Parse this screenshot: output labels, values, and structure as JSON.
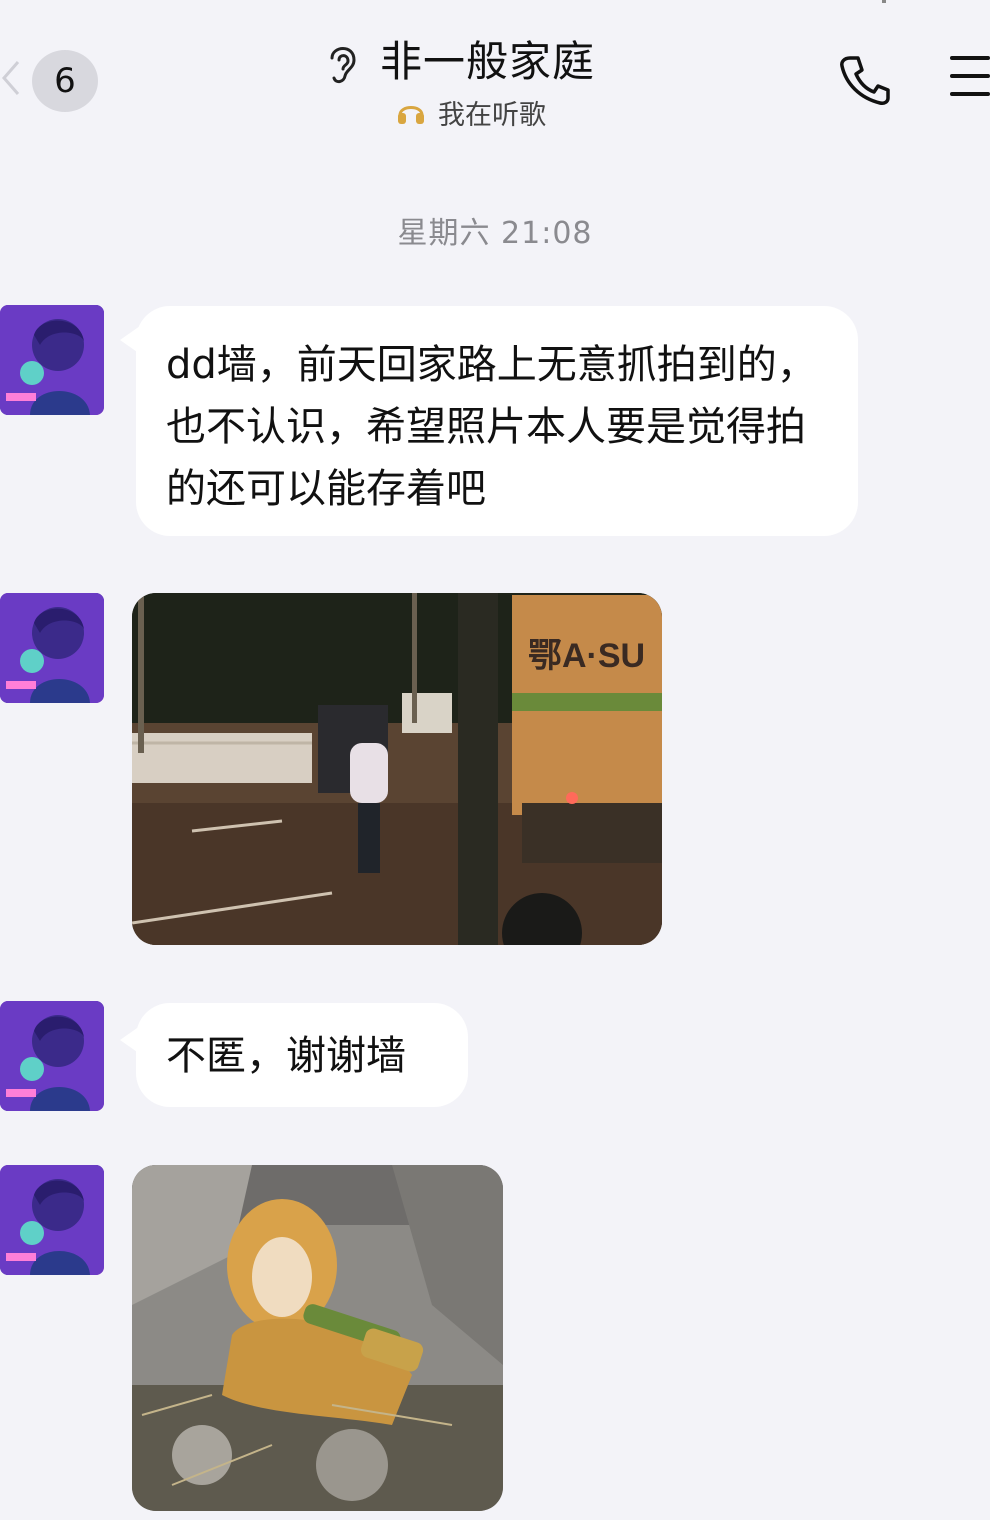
{
  "header": {
    "unread_count": "6",
    "title": "非一般家庭",
    "status_text": "我在听歌",
    "icons": [
      "back-arrow-icon",
      "ear-icon",
      "headphone-icon",
      "phone-icon",
      "menu-icon"
    ]
  },
  "timestamp": "星期六 21:08",
  "messages": [
    {
      "type": "text",
      "text": "dd墙，前天回家路上无意抓拍到的，也不认识，希望照片本人要是觉得拍的还可以能存着吧"
    },
    {
      "type": "image",
      "truck_text": "鄂A·SU"
    },
    {
      "type": "text",
      "text": "不匿，谢谢墙"
    },
    {
      "type": "image"
    }
  ],
  "colors": {
    "background": "#f3f3f8",
    "bubble": "#ffffff",
    "timestamp": "#8a8a8f"
  }
}
